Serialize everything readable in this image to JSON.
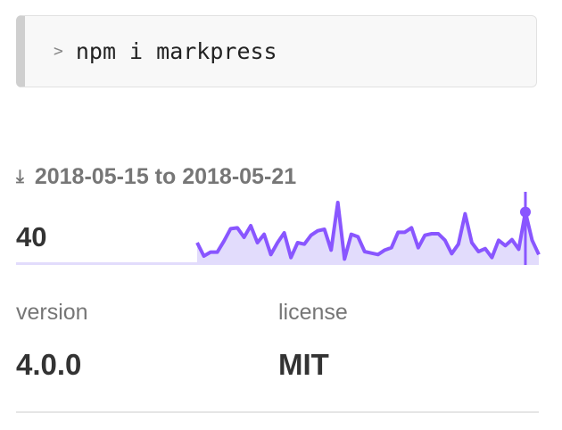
{
  "install": {
    "prompt_icon": "chevron-right-icon",
    "prompt": ">",
    "command": "npm i markpress"
  },
  "downloads": {
    "icon": "download-icon",
    "range_label": "2018-05-15 to 2018-05-21",
    "weekly_count": "40",
    "colors": {
      "line": "#8956ff",
      "fill": "#e2dcfc"
    }
  },
  "chart_data": {
    "type": "area",
    "title": "weekly downloads sparkline",
    "values": [
      75,
      30,
      43,
      43,
      80,
      122,
      125,
      93,
      132,
      75,
      103,
      35,
      75,
      108,
      25,
      75,
      70,
      100,
      115,
      120,
      50,
      210,
      20,
      103,
      95,
      45,
      40,
      35,
      50,
      58,
      110,
      110,
      125,
      58,
      100,
      105,
      105,
      83,
      38,
      70,
      172,
      75,
      45,
      55,
      25,
      83,
      65,
      85,
      53,
      178,
      83,
      35
    ],
    "ylim": [
      0,
      240
    ],
    "highlight_index": 49
  },
  "meta": {
    "version_label": "version",
    "version_value": "4.0.0",
    "license_label": "license",
    "license_value": "MIT"
  }
}
